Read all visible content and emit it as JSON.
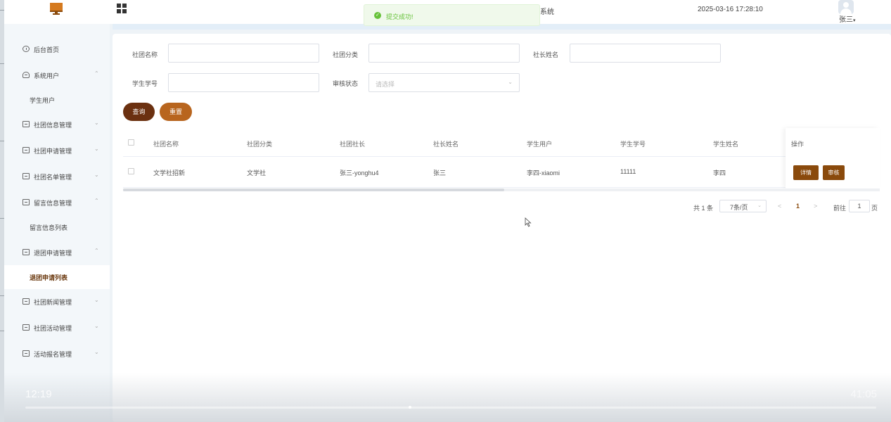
{
  "header": {
    "system_title": "系统",
    "datetime": "2025-03-16 17:28:10",
    "user_name": "张三",
    "user_caret": "▾"
  },
  "toast": {
    "icon": "check-circle-icon",
    "message": "提交成功!",
    "color": "#67c23a"
  },
  "sidebar": {
    "items": [
      {
        "label": "后台首页",
        "icon": "clock-icon",
        "arrow": ""
      },
      {
        "label": "系统用户",
        "icon": "user-icon",
        "arrow": "^"
      },
      {
        "label": "学生用户",
        "sub": true
      },
      {
        "label": "社团信息管理",
        "icon": "form-icon",
        "arrow": "v"
      },
      {
        "label": "社团申请管理",
        "icon": "form-icon",
        "arrow": "v"
      },
      {
        "label": "社团名单管理",
        "icon": "form-icon",
        "arrow": "v"
      },
      {
        "label": "留言信息管理",
        "icon": "form-icon",
        "arrow": "^"
      },
      {
        "label": "留言信息列表",
        "sub": true
      },
      {
        "label": "退团申请管理",
        "icon": "form-icon",
        "arrow": "^"
      },
      {
        "label": "退团申请列表",
        "sub": true,
        "active": true
      },
      {
        "label": "社团新闻管理",
        "icon": "form-icon",
        "arrow": "v"
      },
      {
        "label": "社团活动管理",
        "icon": "form-icon",
        "arrow": "v"
      },
      {
        "label": "活动报名管理",
        "icon": "form-icon",
        "arrow": "v"
      }
    ]
  },
  "filters": {
    "club_name_label": "社团名称",
    "club_category_label": "社团分类",
    "president_name_label": "社长姓名",
    "student_no_label": "学生学号",
    "review_status_label": "审核状态",
    "review_status_placeholder": "请选择",
    "query_label": "查询",
    "reset_label": "重置"
  },
  "table": {
    "columns": [
      "社团名称",
      "社团分类",
      "社团社长",
      "社长姓名",
      "学生用户",
      "学生学号",
      "学生姓名",
      "操作"
    ],
    "rows": [
      {
        "club_name": "文学社招新",
        "category": "文学社",
        "president": "张三-yonghu4",
        "president_name": "张三",
        "student_user": "李四-xiaomi",
        "student_no": "11111",
        "student_name": "李四"
      }
    ],
    "detail_label": "详情",
    "review_label": "审核"
  },
  "pagination": {
    "total_text": "共 1 条",
    "page_size": "7条/页",
    "current_page": "1",
    "goto_label": "前往",
    "goto_value": "1",
    "page_suffix": "页",
    "prev": "<",
    "next": ">"
  },
  "video_overlay": {
    "time_left": "12:19",
    "time_right": "41:05",
    "progress": 0.45
  },
  "colors": {
    "primary": "#6b3010",
    "secondary": "#b8651e",
    "action": "#8a4a0c"
  }
}
